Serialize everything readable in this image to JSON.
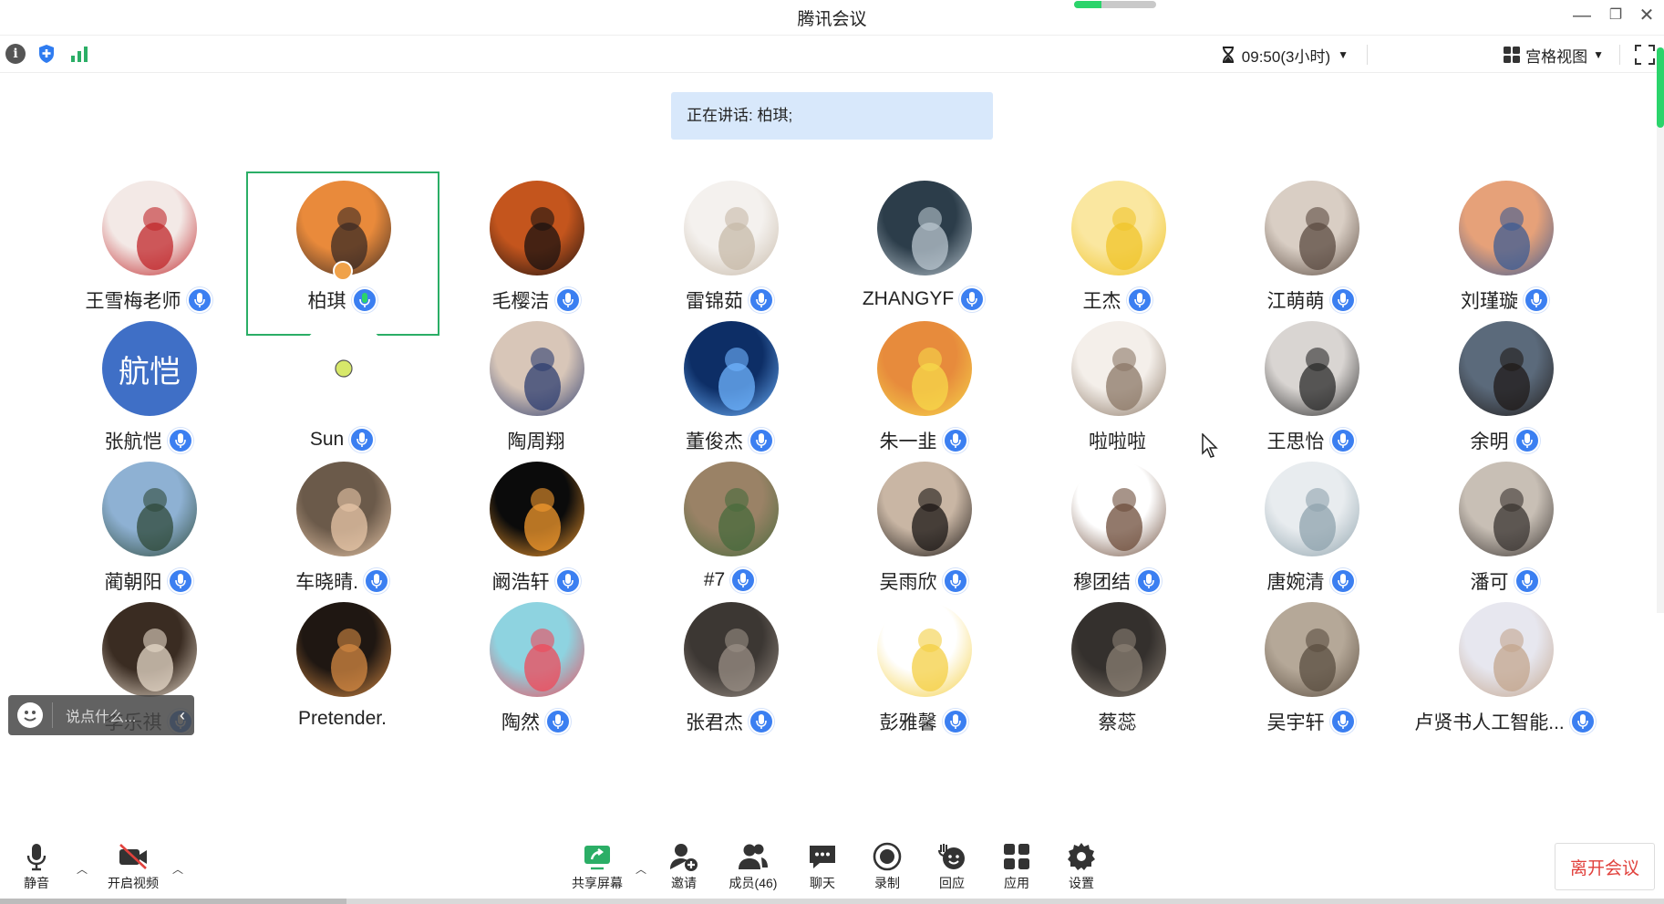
{
  "app": {
    "title": "腾讯会议"
  },
  "toolbar": {
    "timer": "09:50(3小时)",
    "view_label": "宫格视图"
  },
  "speaking": {
    "label": "正在讲话: 柏琪;"
  },
  "participants": [
    {
      "name": "王雪梅老师",
      "mic": true,
      "avatar_color": "#f3e9e6",
      "avatar_accent": "#c0262a"
    },
    {
      "name": "柏琪",
      "mic": true,
      "speaking": true,
      "host": true,
      "avatar_color": "#e98a3b",
      "avatar_accent": "#3a2a24"
    },
    {
      "name": "毛樱洁",
      "mic": true,
      "avatar_color": "#c4551d",
      "avatar_accent": "#1b1210"
    },
    {
      "name": "雷锦茹",
      "mic": true,
      "avatar_color": "#f4f1ee",
      "avatar_accent": "#c7b9a8"
    },
    {
      "name": "ZHANGYF",
      "mic": true,
      "avatar_color": "#2c3d4a",
      "avatar_accent": "#b9c6cf"
    },
    {
      "name": "王杰",
      "mic": true,
      "avatar_color": "#fae7a0",
      "avatar_accent": "#f0c429"
    },
    {
      "name": "江萌萌",
      "mic": true,
      "avatar_color": "#d9cec4",
      "avatar_accent": "#5a4a40"
    },
    {
      "name": "刘瑾璇",
      "mic": true,
      "avatar_color": "#e6a179",
      "avatar_accent": "#3e5c93"
    },
    {
      "name": "张航恺",
      "mic": true,
      "avatar_text": "航恺",
      "avatar_color": "#3f6fc6",
      "avatar_accent": "#3f6fc6"
    },
    {
      "name": "Sun",
      "mic": true,
      "avatar_color": "#ffffff",
      "avatar_accent": "#d7e86a",
      "dot_avatar": true
    },
    {
      "name": "陶周翔",
      "mic": false,
      "avatar_color": "#d8c6b8",
      "avatar_accent": "#2d3d70"
    },
    {
      "name": "董俊杰",
      "mic": true,
      "avatar_color": "#0d2e66",
      "avatar_accent": "#6fb4ff"
    },
    {
      "name": "朱一韭",
      "mic": true,
      "avatar_color": "#e78b3c",
      "avatar_accent": "#f7d84a"
    },
    {
      "name": "啦啦啦",
      "mic": false,
      "avatar_color": "#f4efea",
      "avatar_accent": "#8b7765"
    },
    {
      "name": "王思怡",
      "mic": true,
      "avatar_color": "#d9d5d2",
      "avatar_accent": "#2a2a2a"
    },
    {
      "name": "余明",
      "mic": true,
      "avatar_color": "#5b6a7b",
      "avatar_accent": "#1f1a18"
    },
    {
      "name": "蔺朝阳",
      "mic": true,
      "avatar_color": "#8eb1d3",
      "avatar_accent": "#2f4a3a"
    },
    {
      "name": "车晓晴.",
      "mic": true,
      "avatar_color": "#6b5a4a",
      "avatar_accent": "#e8c7a8"
    },
    {
      "name": "阚浩轩",
      "mic": true,
      "avatar_color": "#0b0b0b",
      "avatar_accent": "#f39a2e"
    },
    {
      "name": "#7",
      "mic": true,
      "avatar_color": "#9a8266",
      "avatar_accent": "#476a3c"
    },
    {
      "name": "吴雨欣",
      "mic": true,
      "avatar_color": "#c9b6a4",
      "avatar_accent": "#1a1614"
    },
    {
      "name": "穆团结",
      "mic": true,
      "avatar_color": "#ffffff",
      "avatar_accent": "#6d4c3a"
    },
    {
      "name": "唐婉清",
      "mic": true,
      "avatar_color": "#e8ecef",
      "avatar_accent": "#8fa3ad"
    },
    {
      "name": "潘可",
      "mic": true,
      "avatar_color": "#c8bfb5",
      "avatar_accent": "#3a3431"
    },
    {
      "name": "李乐祺",
      "mic": true,
      "avatar_color": "#3a2c22",
      "avatar_accent": "#e6d8c8"
    },
    {
      "name": "Pretender.",
      "mic": false,
      "avatar_color": "#1f1712",
      "avatar_accent": "#d58a43"
    },
    {
      "name": "陶然",
      "mic": true,
      "avatar_color": "#8ed3e0",
      "avatar_accent": "#ef4a5a"
    },
    {
      "name": "张君杰",
      "mic": true,
      "avatar_color": "#3c3733",
      "avatar_accent": "#9a8f86"
    },
    {
      "name": "彭雅馨",
      "mic": true,
      "avatar_color": "#ffffff",
      "avatar_accent": "#f4cf43"
    },
    {
      "name": "蔡蕊",
      "mic": false,
      "avatar_color": "#34302d",
      "avatar_accent": "#8a7f73"
    },
    {
      "name": "吴宇轩",
      "mic": true,
      "avatar_color": "#b5a898",
      "avatar_accent": "#5a4d40"
    },
    {
      "name": "卢贤书人工智能...",
      "mic": true,
      "avatar_color": "#e7e7ef",
      "avatar_accent": "#c3a58d"
    }
  ],
  "chat": {
    "placeholder": "说点什么..."
  },
  "controls": {
    "mute": "静音",
    "video": "开启视频",
    "share": "共享屏幕",
    "invite": "邀请",
    "members": "成员(46)",
    "chat": "聊天",
    "record": "录制",
    "react": "回应",
    "apps": "应用",
    "settings": "设置",
    "leave": "离开会议"
  },
  "colors": {
    "accent_blue": "#3b7ff1",
    "speaking_border": "#2bae66",
    "leave_red": "#e1413c",
    "banner_bg": "#d8e8fb"
  }
}
